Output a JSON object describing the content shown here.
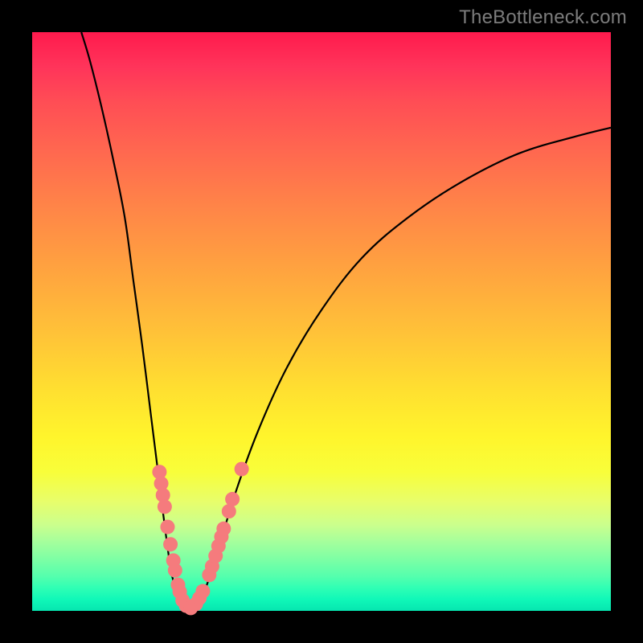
{
  "watermark": "TheBottleneck.com",
  "chart_data": {
    "type": "line",
    "title": "",
    "xlabel": "",
    "ylabel": "",
    "xlim": [
      0,
      100
    ],
    "ylim": [
      0,
      100
    ],
    "curve": {
      "left_branch": [
        {
          "x": 8.5,
          "y": 100
        },
        {
          "x": 10.0,
          "y": 95
        },
        {
          "x": 12.0,
          "y": 87
        },
        {
          "x": 14.0,
          "y": 78
        },
        {
          "x": 16.0,
          "y": 68
        },
        {
          "x": 17.5,
          "y": 57
        },
        {
          "x": 19.0,
          "y": 46
        },
        {
          "x": 20.5,
          "y": 34
        },
        {
          "x": 22.0,
          "y": 22
        },
        {
          "x": 23.0,
          "y": 14
        },
        {
          "x": 24.0,
          "y": 7
        },
        {
          "x": 25.0,
          "y": 3
        },
        {
          "x": 26.0,
          "y": 1
        },
        {
          "x": 27.0,
          "y": 0.3
        }
      ],
      "right_branch": [
        {
          "x": 27.0,
          "y": 0.3
        },
        {
          "x": 28.5,
          "y": 1
        },
        {
          "x": 30.0,
          "y": 4
        },
        {
          "x": 32.0,
          "y": 10
        },
        {
          "x": 35.0,
          "y": 20
        },
        {
          "x": 39.0,
          "y": 31
        },
        {
          "x": 44.0,
          "y": 42
        },
        {
          "x": 50.0,
          "y": 52
        },
        {
          "x": 57.0,
          "y": 61
        },
        {
          "x": 65.0,
          "y": 68
        },
        {
          "x": 74.0,
          "y": 74
        },
        {
          "x": 84.0,
          "y": 79
        },
        {
          "x": 94.0,
          "y": 82
        },
        {
          "x": 100.0,
          "y": 83.5
        }
      ]
    },
    "markers": {
      "color": "#f57b7d",
      "radius_px": 9,
      "points": [
        {
          "x": 22.0,
          "y": 24
        },
        {
          "x": 22.3,
          "y": 22
        },
        {
          "x": 22.6,
          "y": 20
        },
        {
          "x": 22.9,
          "y": 18
        },
        {
          "x": 23.4,
          "y": 14.5
        },
        {
          "x": 23.9,
          "y": 11.5
        },
        {
          "x": 24.4,
          "y": 8.7
        },
        {
          "x": 24.7,
          "y": 7
        },
        {
          "x": 25.2,
          "y": 4.5
        },
        {
          "x": 25.5,
          "y": 3.3
        },
        {
          "x": 26.0,
          "y": 1.8
        },
        {
          "x": 26.6,
          "y": 0.9
        },
        {
          "x": 27.4,
          "y": 0.5
        },
        {
          "x": 28.3,
          "y": 1.2
        },
        {
          "x": 28.9,
          "y": 2.2
        },
        {
          "x": 29.5,
          "y": 3.4
        },
        {
          "x": 30.6,
          "y": 6.2
        },
        {
          "x": 31.1,
          "y": 7.7
        },
        {
          "x": 31.7,
          "y": 9.5
        },
        {
          "x": 32.2,
          "y": 11.2
        },
        {
          "x": 32.7,
          "y": 12.8
        },
        {
          "x": 33.1,
          "y": 14.2
        },
        {
          "x": 34.0,
          "y": 17.2
        },
        {
          "x": 34.6,
          "y": 19.3
        },
        {
          "x": 36.2,
          "y": 24.5
        }
      ]
    },
    "background_gradient": {
      "top": "#ff1a4d",
      "bottom": "#06e6b0",
      "direction": "vertical"
    }
  }
}
